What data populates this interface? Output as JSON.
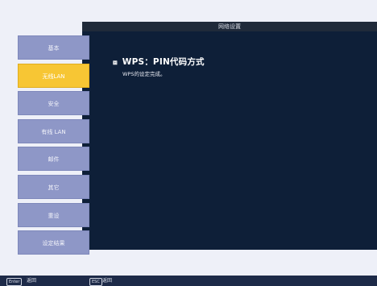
{
  "window": {
    "title": "网络设置"
  },
  "sidebar": {
    "items": [
      {
        "label": "基本",
        "active": false
      },
      {
        "label": "无线LAN",
        "active": true
      },
      {
        "label": "安全",
        "active": false
      },
      {
        "label": "有线 LAN",
        "active": false
      },
      {
        "label": "邮件",
        "active": false
      },
      {
        "label": "其它",
        "active": false
      },
      {
        "label": "重设",
        "active": false
      },
      {
        "label": "设定结果",
        "active": false
      }
    ]
  },
  "content": {
    "icon": "wifi-icon",
    "title": "WPS：PIN代码方式",
    "message": "WPS的设定完成。"
  },
  "footer": {
    "enter_key": "Enter",
    "enter_label": "返回",
    "esc_key": "ESC",
    "esc_label": "返回"
  },
  "colors": {
    "active_item": "#f7c634",
    "menu_item": "#8e97c7",
    "panel": "#0e1f38",
    "footer": "#1d2a48"
  }
}
